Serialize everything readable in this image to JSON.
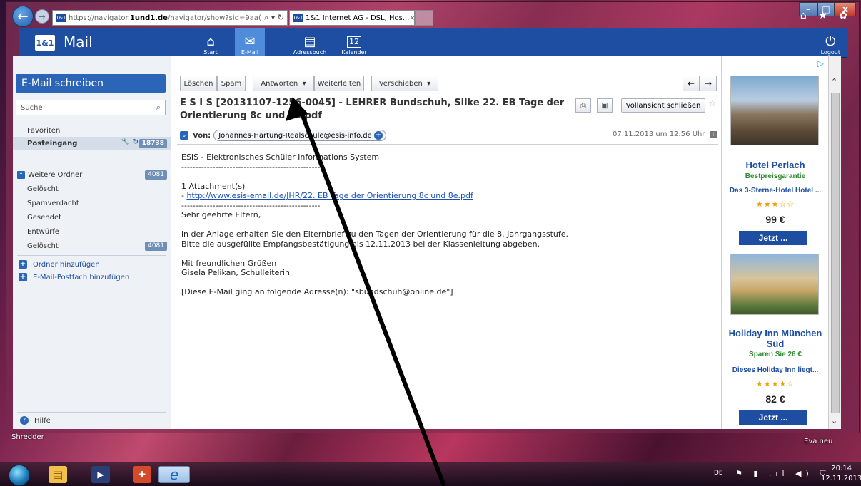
{
  "browser": {
    "url_dim": "https://navigator.",
    "url_domain": "1und1.de",
    "url_rest": "/navigator/show?sid=9aa(",
    "url_controls": "⌕ ▾ ↻",
    "tab_title": "1&1 Internet AG - DSL, Hos...",
    "tab_close": "×",
    "favicon": "1&1",
    "toolbar_icons": "⌂ ★ ✿",
    "win_min": "–",
    "win_max": "□",
    "win_close": "x"
  },
  "topbar": {
    "logo": "1&1",
    "title": "Mail",
    "nav": [
      {
        "label": "Start",
        "icon": "⌂"
      },
      {
        "label": "E-Mail",
        "icon": "✉"
      },
      {
        "label": "Adressbuch",
        "icon": "▤"
      },
      {
        "label": "Kalender",
        "icon": "12"
      }
    ],
    "logout": {
      "label": "Logout",
      "icon": "⏻"
    }
  },
  "sidebar": {
    "compose": "E-Mail schreiben",
    "search_placeholder": "Suche",
    "favorites": "Favoriten",
    "inbox": {
      "label": "Posteingang",
      "count": "18738"
    },
    "more_folders": {
      "label": "Weitere Ordner",
      "count": "4081"
    },
    "folders": [
      {
        "label": "Gelöscht",
        "count": ""
      },
      {
        "label": "Spamverdacht",
        "count": ""
      },
      {
        "label": "Gesendet",
        "count": ""
      },
      {
        "label": "Entwürfe",
        "count": ""
      },
      {
        "label": "Gelöscht",
        "count": "4081"
      }
    ],
    "add_folder": "Ordner hinzufügen",
    "add_mailbox": "E-Mail-Postfach hinzufügen",
    "help": "Hilfe"
  },
  "toolbar": {
    "delete": "Löschen",
    "spam": "Spam",
    "reply": "Antworten",
    "forward": "Weiterleiten",
    "move": "Verschieben",
    "dropdown_arrow": "▾",
    "prev": "←",
    "next": "→"
  },
  "message": {
    "subject_line1": "E S I S [20131107-1256-0045] - LEHRER Bundschuh, Silke 22. EB Tage der",
    "subject_line2": "Orientierung 8c und 8e.pdf",
    "close_full_view": "Vollansicht schließen",
    "from_label": "Von:",
    "from_address": "Johannes-Hartung-Realschule@esis-info.de",
    "date": "07.11.2013 um 12:56 Uhr",
    "body_line1": "ESIS - Elektronisches Schüler Informations System",
    "body_line2": "-------------------------------------------------",
    "body_line3": "1 Attachment(s)",
    "body_link_prefix": "- ",
    "body_link": "http://www.esis-email.de/JHR/22. EB Tage der Orientierung 8c und 8e.pdf",
    "body_line5": "-------------------------------------------------",
    "body_greeting": "Sehr geehrte Eltern,",
    "body_p1": "in der Anlage erhalten Sie den Elternbrief zu den Tagen der Orientierung für die 8. Jahrgangsstufe.",
    "body_p2": "Bitte die ausgefüllte Empfangsbestätigung bis 12.11.2013 bei der Klassenleitung abgeben.",
    "body_closing1": "Mit freundlichen Grüßen",
    "body_closing2": "Gisela Pelikan, Schulleiterin",
    "body_footer": "[Diese E-Mail ging an folgende Adresse(n): \"sbundschuh@online.de\"]"
  },
  "ads": [
    {
      "name": "Hotel Perlach",
      "tag": "Bestpreisgarantie",
      "desc": "Das 3-Sterne-Hotel Hotel ...",
      "stars": "★★★☆☆",
      "price": "99 €",
      "cta": "Jetzt ..."
    },
    {
      "name": "Holiday Inn München Süd",
      "tag": "Sparen Sie 26 €",
      "desc": "Dieses Holiday Inn liegt...",
      "stars": "★★★★☆",
      "price": "82 €",
      "cta": "Jetzt ..."
    }
  ],
  "desktop": {
    "label_left": "Shredder",
    "label_right": "Eva neu"
  },
  "taskbar": {
    "lang": "DE",
    "tray_icons": "⚑ ▮ .ıl ◀) ⛉",
    "time": "20:14",
    "date": "12.11.2013"
  }
}
